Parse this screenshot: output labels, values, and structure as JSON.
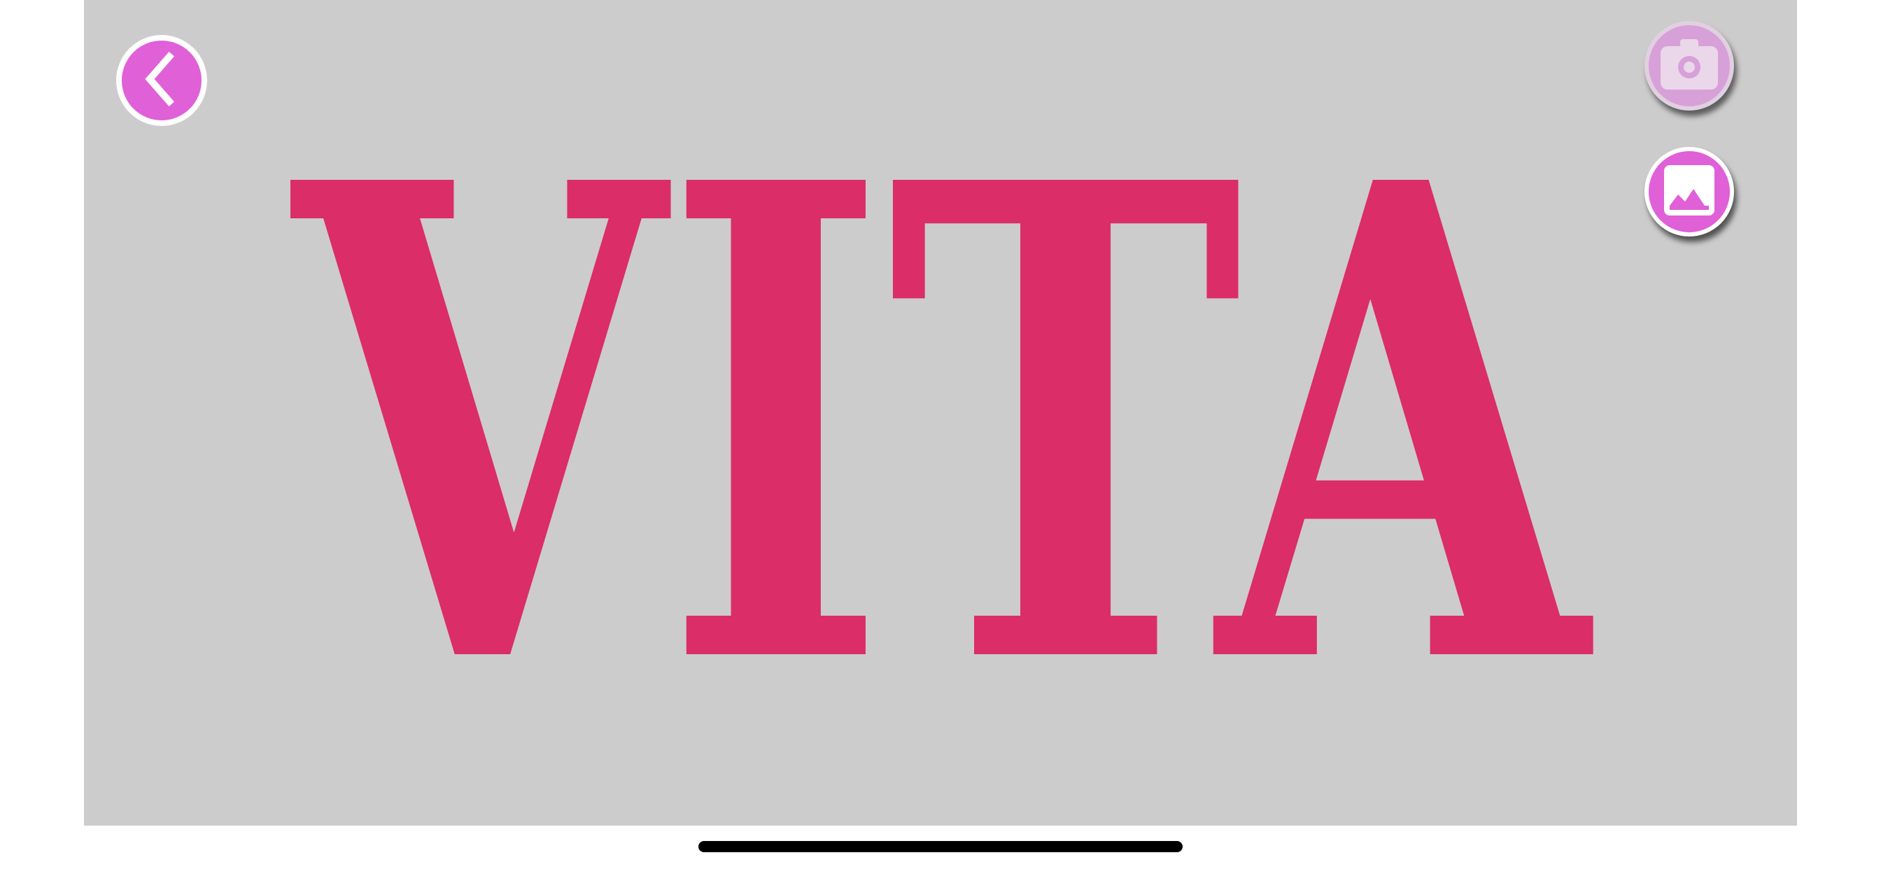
{
  "canvas": {
    "background_color": "#cccccc",
    "word": "VITA",
    "text_color": "#db2d68"
  },
  "buttons": {
    "back": {
      "icon": "chevron-left-icon",
      "color": "#e060d8"
    },
    "camera": {
      "icon": "camera-icon",
      "color": "#d8a0d8"
    },
    "gallery": {
      "icon": "image-gallery-icon",
      "color": "#e060d8"
    }
  },
  "home_indicator": {
    "color": "#000000"
  }
}
